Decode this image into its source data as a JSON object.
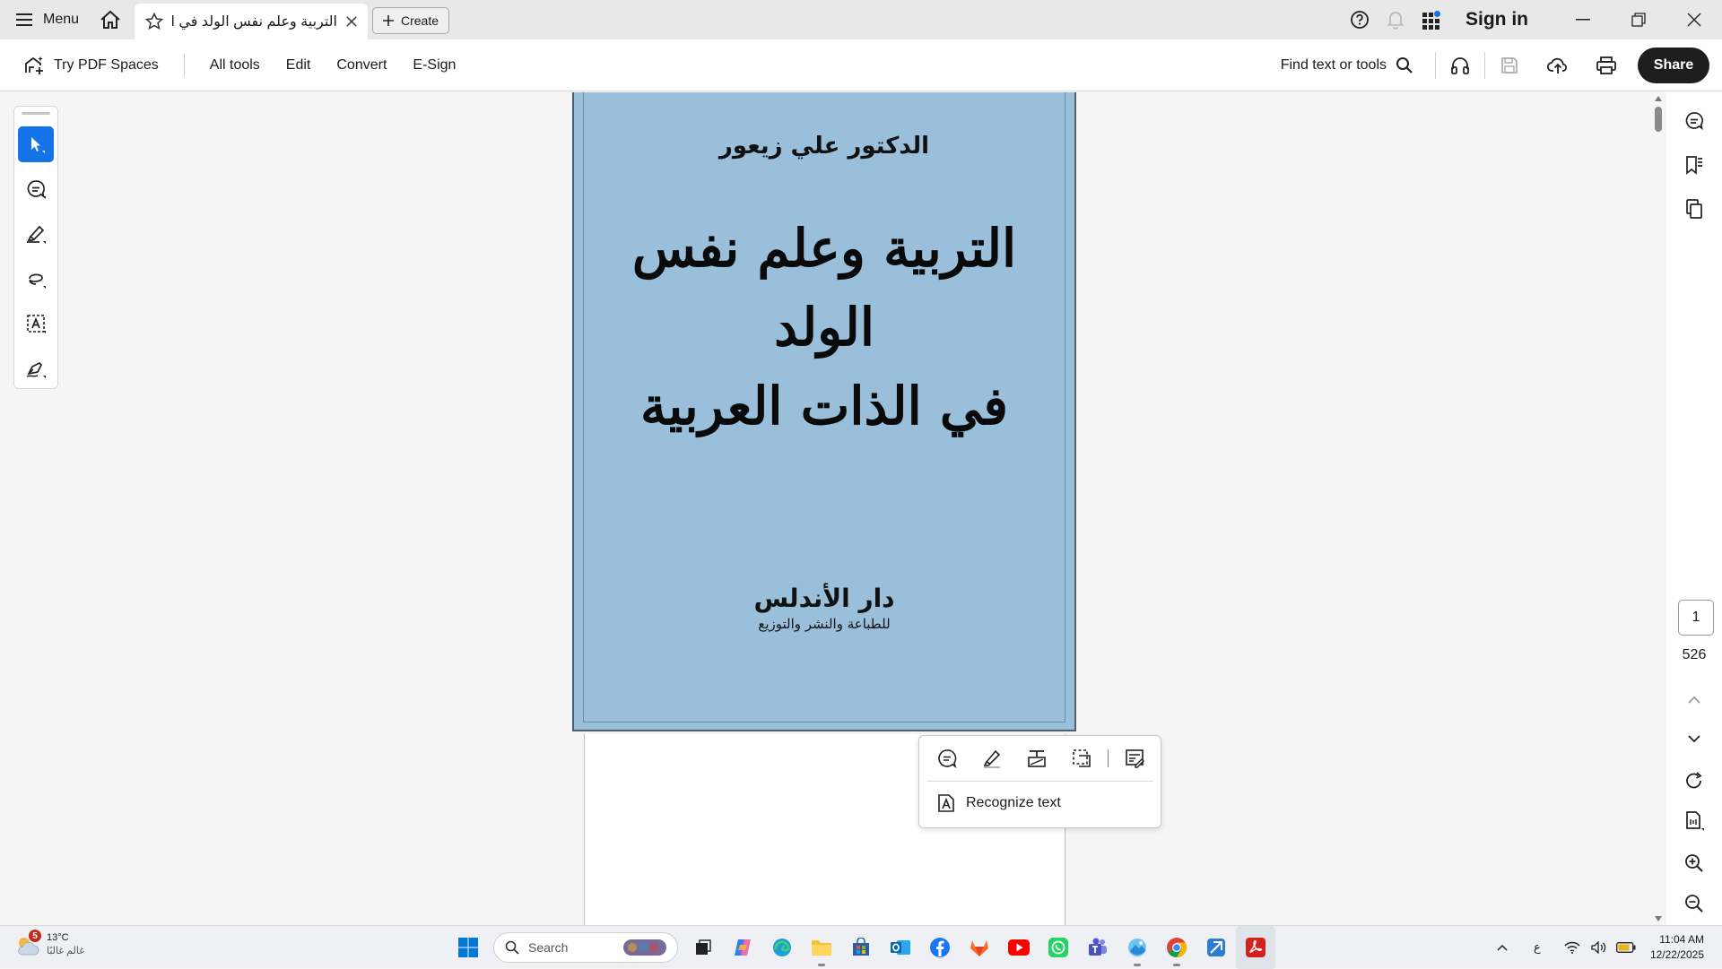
{
  "titlebar": {
    "menu_label": "Menu",
    "tab_title": "التربية وعلم نفس الولد في الذا...",
    "create_label": "Create",
    "sign_in_label": "Sign in"
  },
  "toolbar": {
    "try_pdf_spaces": "Try PDF Spaces",
    "all_tools": "All tools",
    "edit": "Edit",
    "convert": "Convert",
    "esign": "E-Sign",
    "find_placeholder": "Find text or tools",
    "share_label": "Share"
  },
  "left_rail": {
    "tools": [
      "select-tool",
      "comment-tool",
      "highlight-tool",
      "draw-tool",
      "text-select-tool",
      "sign-tool"
    ],
    "active_tool": "select-tool"
  },
  "document": {
    "author": "الدكتور علي زيعور",
    "title_line1": "التربية وعلم نفس الولد",
    "title_line2": "في الذات العربية",
    "publisher": "دار الأندلس",
    "publisher_sub": "للطباعة والنشر والتوزيع",
    "cover_color": "#99bfda"
  },
  "popup": {
    "recognize_text": "Recognize text"
  },
  "page_nav": {
    "current_page": "1",
    "total_pages": "526"
  },
  "taskbar": {
    "weather_badge": "5",
    "temperature": "13°C",
    "weather_label": "غالم غالبًا",
    "search_placeholder": "Search",
    "lang_indicator": "ع",
    "time": "11:04 AM",
    "date": "12/22/2025"
  },
  "colors": {
    "accent": "#1473e6",
    "share_button": "#1e1e1e",
    "titlebar_bg": "#e8e8e8"
  }
}
